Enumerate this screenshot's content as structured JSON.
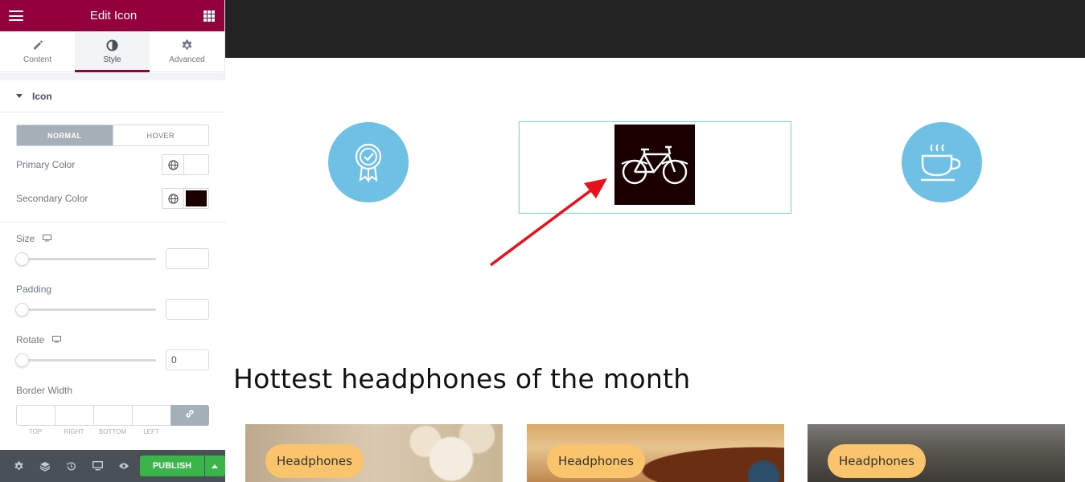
{
  "sidebar": {
    "header": {
      "title": "Edit Icon"
    },
    "tabs": [
      {
        "label": "Content",
        "icon": "pencil-icon"
      },
      {
        "label": "Style",
        "icon": "contrast-icon",
        "active": true
      },
      {
        "label": "Advanced",
        "icon": "gear-icon"
      }
    ],
    "section": {
      "title": "Icon"
    },
    "state_toggle": {
      "normal": "NORMAL",
      "hover": "HOVER",
      "active": "normal"
    },
    "primary_color": {
      "label": "Primary Color",
      "value": ""
    },
    "secondary_color": {
      "label": "Secondary Color",
      "value": "#1a0000"
    },
    "size": {
      "label": "Size",
      "value": ""
    },
    "padding": {
      "label": "Padding",
      "value": ""
    },
    "rotate": {
      "label": "Rotate",
      "value": "0"
    },
    "border_width": {
      "label": "Border Width",
      "sides": [
        "TOP",
        "RIGHT",
        "BOTTOM",
        "LEFT"
      ]
    },
    "footer": {
      "publish": "PUBLISH"
    }
  },
  "canvas": {
    "icons": [
      "badge-award-icon",
      "bicycle-icon",
      "coffee-cup-icon"
    ],
    "heading": "Hottest headphones of the month",
    "cards": [
      {
        "tag": "Headphones"
      },
      {
        "tag": "Headphones"
      },
      {
        "tag": "Headphones"
      }
    ]
  },
  "colors": {
    "brand": "#93003c",
    "icon_circle": "#6ec1e4",
    "publish": "#39b54a",
    "tag_pill": "#f9c46b",
    "annotation_arrow": "#e8101a"
  }
}
